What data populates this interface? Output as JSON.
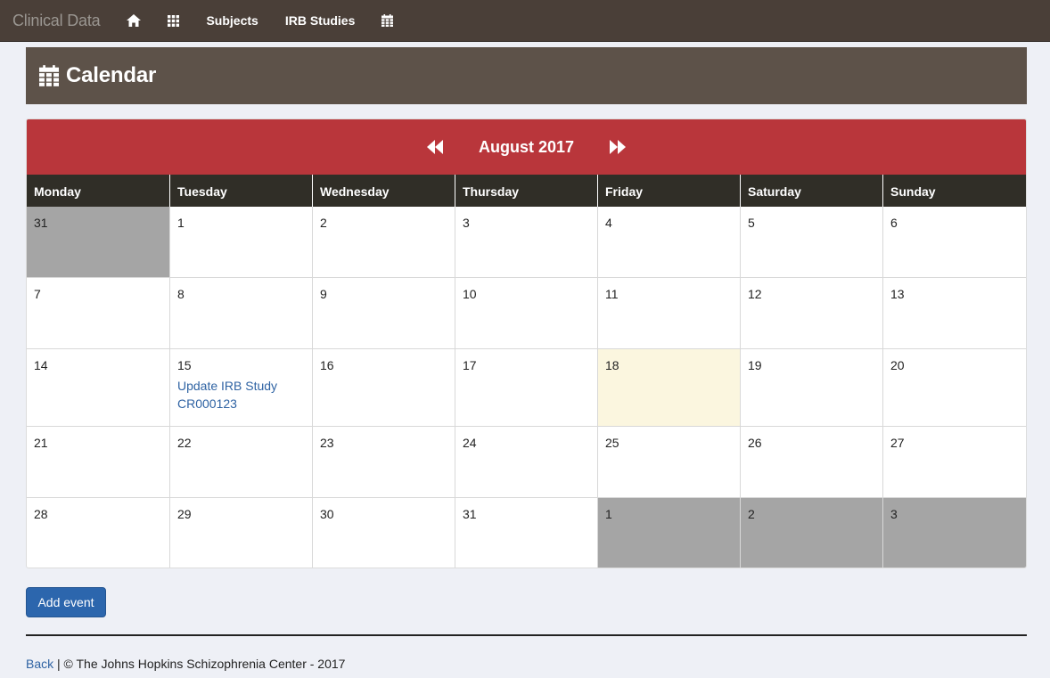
{
  "navbar": {
    "brand": "Clinical Data",
    "items": [
      {
        "label": "Subjects"
      },
      {
        "label": "IRB Studies"
      }
    ],
    "icons": [
      "home-icon",
      "grid-icon",
      "calendar-icon"
    ]
  },
  "page": {
    "title": "Calendar"
  },
  "calendar": {
    "month_label": "August 2017",
    "weekdays": [
      "Monday",
      "Tuesday",
      "Wednesday",
      "Thursday",
      "Friday",
      "Saturday",
      "Sunday"
    ],
    "weeks": [
      [
        {
          "day": "31",
          "other": true
        },
        {
          "day": "1"
        },
        {
          "day": "2"
        },
        {
          "day": "3"
        },
        {
          "day": "4"
        },
        {
          "day": "5"
        },
        {
          "day": "6"
        }
      ],
      [
        {
          "day": "7"
        },
        {
          "day": "8"
        },
        {
          "day": "9"
        },
        {
          "day": "10"
        },
        {
          "day": "11"
        },
        {
          "day": "12"
        },
        {
          "day": "13"
        }
      ],
      [
        {
          "day": "14"
        },
        {
          "day": "15",
          "event": "Update IRB Study CR000123"
        },
        {
          "day": "16"
        },
        {
          "day": "17"
        },
        {
          "day": "18",
          "today": true
        },
        {
          "day": "19"
        },
        {
          "day": "20"
        }
      ],
      [
        {
          "day": "21"
        },
        {
          "day": "22"
        },
        {
          "day": "23"
        },
        {
          "day": "24"
        },
        {
          "day": "25"
        },
        {
          "day": "26"
        },
        {
          "day": "27"
        }
      ],
      [
        {
          "day": "28"
        },
        {
          "day": "29"
        },
        {
          "day": "30"
        },
        {
          "day": "31"
        },
        {
          "day": "1",
          "other": true
        },
        {
          "day": "2",
          "other": true
        },
        {
          "day": "3",
          "other": true
        }
      ]
    ],
    "colors": {
      "header": "#b9363b",
      "weekday_bar": "#302e27",
      "other_month": "#a5a5a5",
      "today": "#fbf6df"
    }
  },
  "actions": {
    "add_event_label": "Add event"
  },
  "footer": {
    "back_label": "Back",
    "text": " | © The Johns Hopkins Schizophrenia Center - 2017"
  }
}
